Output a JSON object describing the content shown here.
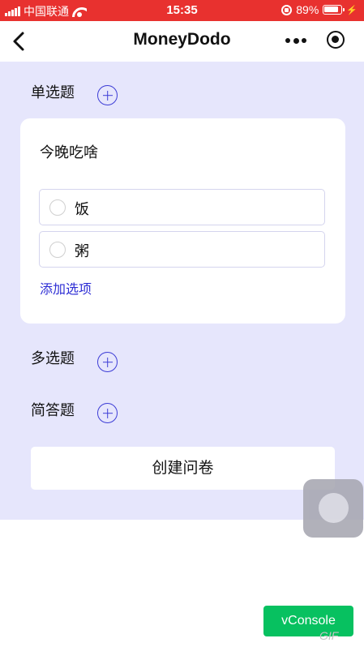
{
  "status_bar": {
    "carrier": "中国联通",
    "time": "15:35",
    "battery_percent": "89%",
    "battery_level": 0.89
  },
  "nav": {
    "title": "MoneyDodo"
  },
  "sections": {
    "single_choice": {
      "label": "单选题"
    },
    "multi_choice": {
      "label": "多选题"
    },
    "short_answer": {
      "label": "简答题"
    }
  },
  "card": {
    "question_title": "今晚吃啥",
    "options": [
      {
        "label": "饭"
      },
      {
        "label": "粥"
      }
    ],
    "add_option_label": "添加选项"
  },
  "create_button": {
    "label": "创建问卷"
  },
  "vconsole": {
    "label": "vConsole"
  },
  "watermark": {
    "text": "GIF"
  },
  "colors": {
    "status_bar": "#e8312f",
    "content_bg": "#e6e6fc",
    "accent": "#3d3dd6",
    "vconsole": "#07c160"
  },
  "icons": [
    "signal-icon",
    "wifi-icon",
    "orientation-lock-icon",
    "battery-icon",
    "charging-icon",
    "back-arrow-icon",
    "more-dots-icon",
    "close-target-icon",
    "plus-circle-icon",
    "radio-icon"
  ]
}
